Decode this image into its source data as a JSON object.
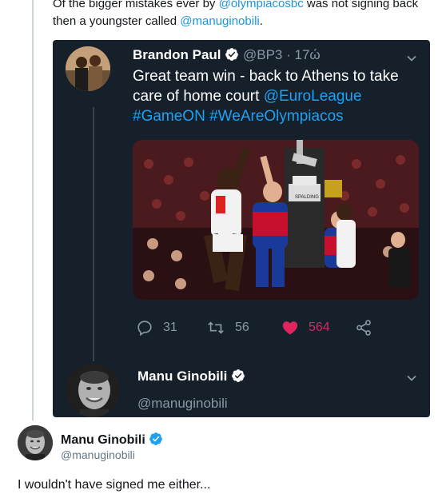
{
  "context_tweet": {
    "text_before": "Of the bigger mistakes ever by ",
    "mention_1": "@olympiacosbc",
    "text_middle": " was not signing back then a youngster called ",
    "mention_2": "@manuginobili",
    "text_after": "."
  },
  "quoted_tweet": {
    "author_name": "Brandon Paul",
    "author_handle": "@BP3",
    "separator": "·",
    "time": "17ώ",
    "text_plain": "Great team win - back to Athens to take care of home court ",
    "link_mention": "@EuroLeague",
    "hashtag_1": "#GameON",
    "hashtag_2": "#WeAreOlympiacos",
    "reply_count": "31",
    "retweet_count": "56",
    "like_count": "564",
    "media_banner": "SPALDING"
  },
  "reply_in_card": {
    "author_name": "Manu Ginobili",
    "author_handle": "@manuginobili"
  },
  "main_tweet": {
    "author_name": "Manu Ginobili",
    "author_handle": "@manuginobili",
    "text": "I wouldn't have signed me either..."
  },
  "colors": {
    "accent": "#1da1f2",
    "like": "#e0245e",
    "card_bg": "#15202b",
    "muted": "#8899a6"
  }
}
